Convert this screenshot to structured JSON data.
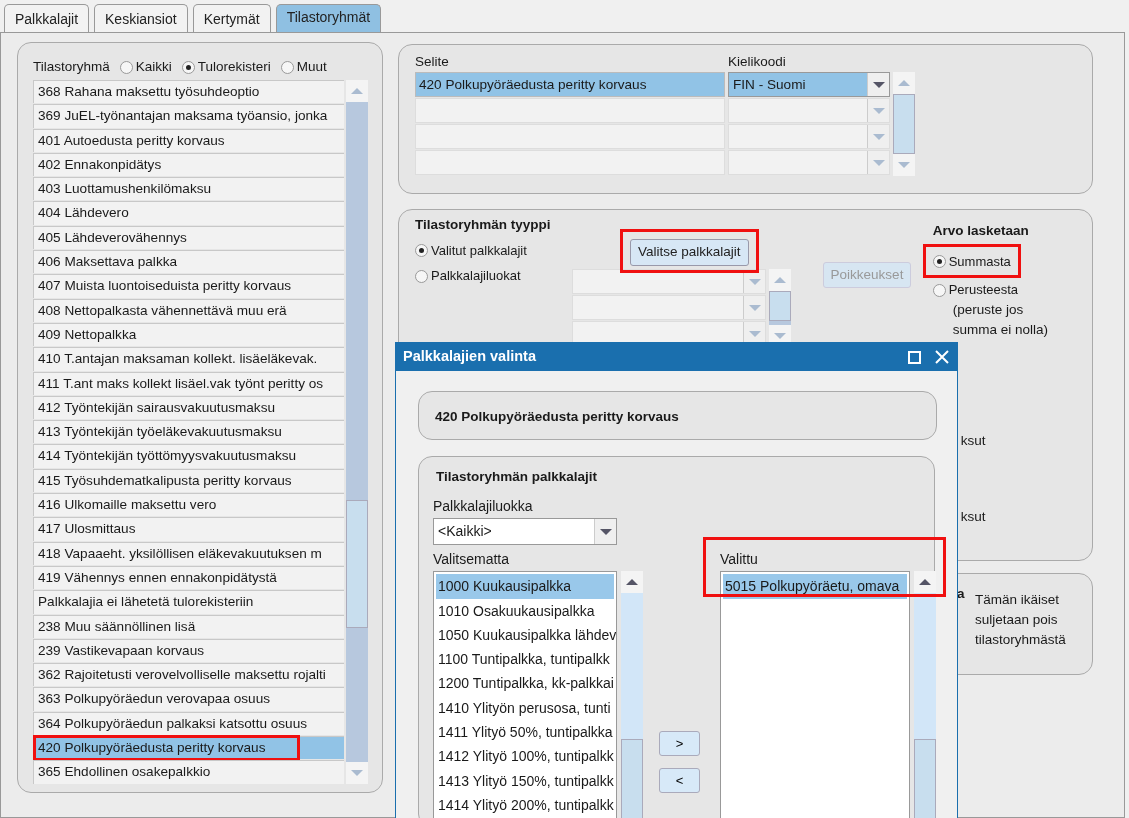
{
  "tabs": [
    {
      "label": "Palkkalajit",
      "selected": false
    },
    {
      "label": "Keskiansiot",
      "selected": false
    },
    {
      "label": "Kertymät",
      "selected": false
    },
    {
      "label": "Tilastoryhmät",
      "selected": true
    }
  ],
  "group_filter": {
    "label": "Tilastoryhmä",
    "options": [
      {
        "label": "Kaikki",
        "selected": false
      },
      {
        "label": "Tulorekisteri",
        "selected": true
      },
      {
        "label": "Muut",
        "selected": false
      }
    ]
  },
  "groups": [
    {
      "label": "368 Rahana maksettu työsuhdeoptio",
      "selected": false,
      "highlighted": false
    },
    {
      "label": "369 JuEL-työnantajan maksama työansio, jonka",
      "selected": false,
      "highlighted": false
    },
    {
      "label": "401 Autoedusta peritty korvaus",
      "selected": false,
      "highlighted": false
    },
    {
      "label": "402 Ennakonpidätys",
      "selected": false,
      "highlighted": false
    },
    {
      "label": "403 Luottamushenkilömaksu",
      "selected": false,
      "highlighted": false
    },
    {
      "label": "404 Lähdevero",
      "selected": false,
      "highlighted": false
    },
    {
      "label": "405 Lähdeverovähennys",
      "selected": false,
      "highlighted": false
    },
    {
      "label": "406 Maksettava palkka",
      "selected": false,
      "highlighted": false
    },
    {
      "label": "407 Muista luontoiseduista peritty korvaus",
      "selected": false,
      "highlighted": false
    },
    {
      "label": "408 Nettopalkasta vähennettävä muu erä",
      "selected": false,
      "highlighted": false
    },
    {
      "label": "409 Nettopalkka",
      "selected": false,
      "highlighted": false
    },
    {
      "label": "410 T.antajan maksaman kollekt. lisäeläkevak.",
      "selected": false,
      "highlighted": false
    },
    {
      "label": "411 T.ant maks kollekt lisäel.vak työnt peritty os",
      "selected": false,
      "highlighted": false
    },
    {
      "label": "412 Työntekijän sairausvakuutusmaksu",
      "selected": false,
      "highlighted": false
    },
    {
      "label": "413 Työntekijän työeläkevakuutusmaksu",
      "selected": false,
      "highlighted": false
    },
    {
      "label": "414 Työntekijän työttömyysvakuutusmaksu",
      "selected": false,
      "highlighted": false
    },
    {
      "label": "415 Työsuhdematkalipusta peritty korvaus",
      "selected": false,
      "highlighted": false
    },
    {
      "label": "416 Ulkomaille maksettu vero",
      "selected": false,
      "highlighted": false
    },
    {
      "label": "417 Ulosmittaus",
      "selected": false,
      "highlighted": false
    },
    {
      "label": "418 Vapaaeht. yksilöllisen eläkevakuutuksen m",
      "selected": false,
      "highlighted": false
    },
    {
      "label": "419 Vähennys ennen ennakonpidätystä",
      "selected": false,
      "highlighted": false
    },
    {
      "label": "Palkkalajia ei lähetetä tulorekisteriin",
      "selected": false,
      "highlighted": false
    },
    {
      "label": "238 Muu säännöllinen lisä",
      "selected": false,
      "highlighted": false
    },
    {
      "label": "239 Vastikevapaan korvaus",
      "selected": false,
      "highlighted": false
    },
    {
      "label": "362 Rajoitetusti verovelvolliselle maksettu rojalti",
      "selected": false,
      "highlighted": false
    },
    {
      "label": "363 Polkupyöräedun verovapaa osuus",
      "selected": false,
      "highlighted": false
    },
    {
      "label": "364 Polkupyöräedun palkaksi katsottu osuus",
      "selected": false,
      "highlighted": false
    },
    {
      "label": "420 Polkupyöräedusta peritty korvaus",
      "selected": true,
      "highlighted": true
    },
    {
      "label": "365 Ehdollinen osakepalkkio",
      "selected": false,
      "highlighted": false
    }
  ],
  "descriptions": {
    "columns": [
      "Selite",
      "Kielikoodi"
    ],
    "rows": [
      {
        "selite": "420 Polkupyöräedusta peritty korvaus",
        "kielikoodi": "FIN - Suomi",
        "selected": true
      }
    ]
  },
  "group_type": {
    "title": "Tilastoryhmän tyyppi",
    "options": [
      {
        "label": "Valitut palkkalajit",
        "selected": true
      },
      {
        "label": "Palkkalajiluokat",
        "selected": false
      }
    ],
    "select_button": {
      "label": "Valitse palkkalajit",
      "highlighted": true
    },
    "exceptions_button": {
      "label": "Poikkeukset",
      "disabled": true
    }
  },
  "calculation": {
    "title": "Arvo lasketaan",
    "options": [
      {
        "label": "Summasta",
        "selected": true,
        "highlighted": true
      },
      {
        "label": "Perusteesta",
        "selected": false,
        "highlighted": false
      }
    ],
    "note": "(peruste jos summa ei nolla)"
  },
  "obscured_fragments": [
    "ksut",
    "ksut"
  ],
  "age_panel": {
    "title_fragment": "a",
    "text": "Tämän ikäiset suljetaan pois tilastoryhmästä"
  },
  "dialog": {
    "title": "Palkkalajien valinta",
    "header": "420 Polkupyöräedusta peritty korvaus",
    "section_title": "Tilastoryhmän palkkalajit",
    "class_label": "Palkkalajiluokka",
    "class_value": "<Kaikki>",
    "available": {
      "label": "Valitsematta",
      "items": [
        {
          "label": "1000 Kuukausipalkka",
          "selected": true
        },
        {
          "label": "1010 Osakuukausipalkka",
          "selected": false
        },
        {
          "label": "1050 Kuukausipalkka lähdev",
          "selected": false
        },
        {
          "label": "1100 Tuntipalkka, tuntipalkk",
          "selected": false
        },
        {
          "label": "1200 Tuntipalkka, kk-palkkai",
          "selected": false
        },
        {
          "label": "1410 Ylityön perusosa, tunti",
          "selected": false
        },
        {
          "label": "1411 Ylityö 50%, tuntipalkka",
          "selected": false
        },
        {
          "label": "1412 Ylityö 100%, tuntipalkk",
          "selected": false
        },
        {
          "label": "1413 Ylityö 150%, tuntipalkk",
          "selected": false
        },
        {
          "label": "1414 Ylityö 200%, tuntipalkk",
          "selected": false
        }
      ]
    },
    "chosen": {
      "label": "Valittu",
      "highlighted": true,
      "items": [
        {
          "label": "5015 Polkupyöräetu, omava",
          "selected": true
        }
      ]
    },
    "add_button": ">",
    "remove_button": "<"
  }
}
